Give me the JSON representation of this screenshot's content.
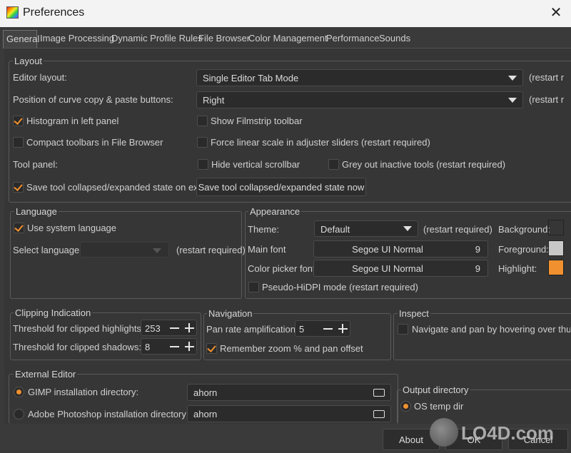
{
  "window": {
    "title": "Preferences",
    "close_glyph": "✕"
  },
  "tabs": [
    "General",
    "Image Processing",
    "Dynamic Profile Rules",
    "File Browser",
    "Color Management",
    "Performance",
    "Sounds"
  ],
  "layout": {
    "title": "Layout",
    "editor_layout_label": "Editor layout:",
    "editor_layout_value": "Single Editor Tab Mode",
    "restart1": "(restart r",
    "curve_label": "Position of curve copy & paste buttons:",
    "curve_value": "Right",
    "restart2": "(restart r",
    "histogram_left": "Histogram in left panel",
    "show_filmstrip": "Show Filmstrip toolbar",
    "compact_toolbars": "Compact toolbars in File Browser",
    "force_linear": "Force linear scale in adjuster sliders (restart required)",
    "tool_panel_label": "Tool panel:",
    "hide_scrollbar": "Hide vertical scrollbar",
    "grey_inactive": "Grey out inactive tools (restart required)",
    "save_state_exit": "Save tool collapsed/expanded state on exit",
    "save_state_now": "Save tool collapsed/expanded state now"
  },
  "language": {
    "title": "Language",
    "use_system": "Use system language",
    "select_label": "Select language:",
    "select_value": "",
    "restart": "(restart required)"
  },
  "appearance": {
    "title": "Appearance",
    "theme_label": "Theme:",
    "theme_value": "Default",
    "theme_restart": "(restart required)",
    "background_label": "Background:",
    "main_font_label": "Main font",
    "main_font_value": "Segoe UI Normal",
    "main_font_size": "9",
    "foreground_label": "Foreground:",
    "picker_font_label": "Color picker font:",
    "picker_font_value": "Segoe UI Normal",
    "picker_font_size": "9",
    "highlight_label": "Highlight:",
    "pseudo_hidpi": "Pseudo-HiDPI mode (restart required)",
    "colors": {
      "background": "#3a3a3a",
      "foreground": "#c8c8c8",
      "highlight": "#f0902e"
    }
  },
  "clipping": {
    "title": "Clipping Indication",
    "highlights_label": "Threshold for clipped highlights:",
    "highlights_value": "253",
    "shadows_label": "Threshold for clipped shadows:",
    "shadows_value": "8"
  },
  "navigation": {
    "title": "Navigation",
    "pan_label": "Pan rate amplification:",
    "pan_value": "5",
    "remember_zoom": "Remember zoom % and pan offset"
  },
  "inspect": {
    "title": "Inspect",
    "hover_nav": "Navigate and pan by hovering over thun"
  },
  "external_editor": {
    "title": "External Editor",
    "gimp_label": "GIMP installation directory:",
    "gimp_value": "ahorn",
    "photoshop_label": "Adobe Photoshop installation directory:",
    "photoshop_value": "ahorn"
  },
  "output_dir": {
    "title": "Output directory",
    "os_temp": "OS temp dir"
  },
  "footer": {
    "about": "About",
    "ok": "OK",
    "cancel": "Cancel"
  },
  "watermark": "LO4D.com"
}
